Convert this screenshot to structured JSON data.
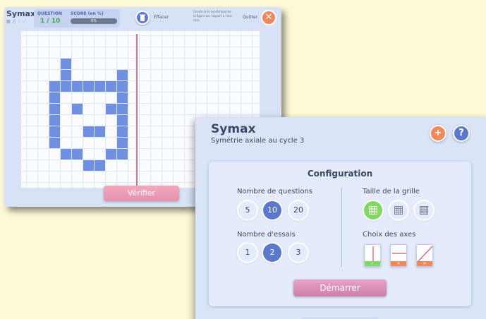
{
  "game_window": {
    "app_name": "Symax",
    "mini_text": "▦ ▯ – ⟋",
    "question_label": "QUESTION",
    "question_value": "1 / 10",
    "score_label": "SCORE (en %)",
    "score_value": "0%",
    "effacer_label": "Effacer",
    "instruction": "Construis le symétrique de la figure par rapport à l'axe rose.",
    "quit_label": "Quitter",
    "close_glyph": "✕",
    "verify_label": "Vérifier",
    "drawn_cells": [
      [
        3,
        2
      ],
      [
        3,
        3
      ],
      [
        8,
        3
      ],
      [
        2,
        4
      ],
      [
        3,
        4
      ],
      [
        4,
        4
      ],
      [
        5,
        4
      ],
      [
        6,
        4
      ],
      [
        7,
        4
      ],
      [
        8,
        4
      ],
      [
        2,
        5
      ],
      [
        8,
        5
      ],
      [
        2,
        6
      ],
      [
        4,
        6
      ],
      [
        7,
        6
      ],
      [
        8,
        6
      ],
      [
        2,
        7
      ],
      [
        8,
        7
      ],
      [
        2,
        8
      ],
      [
        5,
        8
      ],
      [
        6,
        8
      ],
      [
        8,
        8
      ],
      [
        2,
        9
      ],
      [
        8,
        9
      ],
      [
        3,
        10
      ],
      [
        4,
        10
      ],
      [
        7,
        10
      ],
      [
        8,
        10
      ],
      [
        5,
        11
      ],
      [
        6,
        11
      ]
    ],
    "colors": {
      "cell": "#6f8fe3",
      "axis": "#de6f7a",
      "close": "#f0885b"
    }
  },
  "config_window": {
    "title": "Symax",
    "subtitle": "Symétrie axiale au cycle 3",
    "plus_glyph": "+",
    "help_glyph": "?",
    "card_title": "Configuration",
    "questions_label": "Nombre de questions",
    "questions_options": [
      "5",
      "10",
      "20"
    ],
    "questions_selected": "10",
    "attempts_label": "Nombre d'essais",
    "attempts_options": [
      "1",
      "2",
      "3"
    ],
    "attempts_selected": "2",
    "grid_size_label": "Taille de la grille",
    "grid_size_icons": [
      "grid-small-icon",
      "grid-medium-icon",
      "grid-large-icon"
    ],
    "grid_size_selected": "grid-small-icon",
    "axes_label": "Choix des axes",
    "axes": [
      {
        "icon": "vertical-axis-icon",
        "state": "✓"
      },
      {
        "icon": "horizontal-axis-icon",
        "state": "✕"
      },
      {
        "icon": "diagonal-axis-icon",
        "state": "✕"
      }
    ],
    "start_label": "Démarrer",
    "colors": {
      "selected": "#5b78cf",
      "accent_orange": "#f0885b",
      "accent_green": "#7fd860",
      "start": "#cd7fa8"
    }
  }
}
